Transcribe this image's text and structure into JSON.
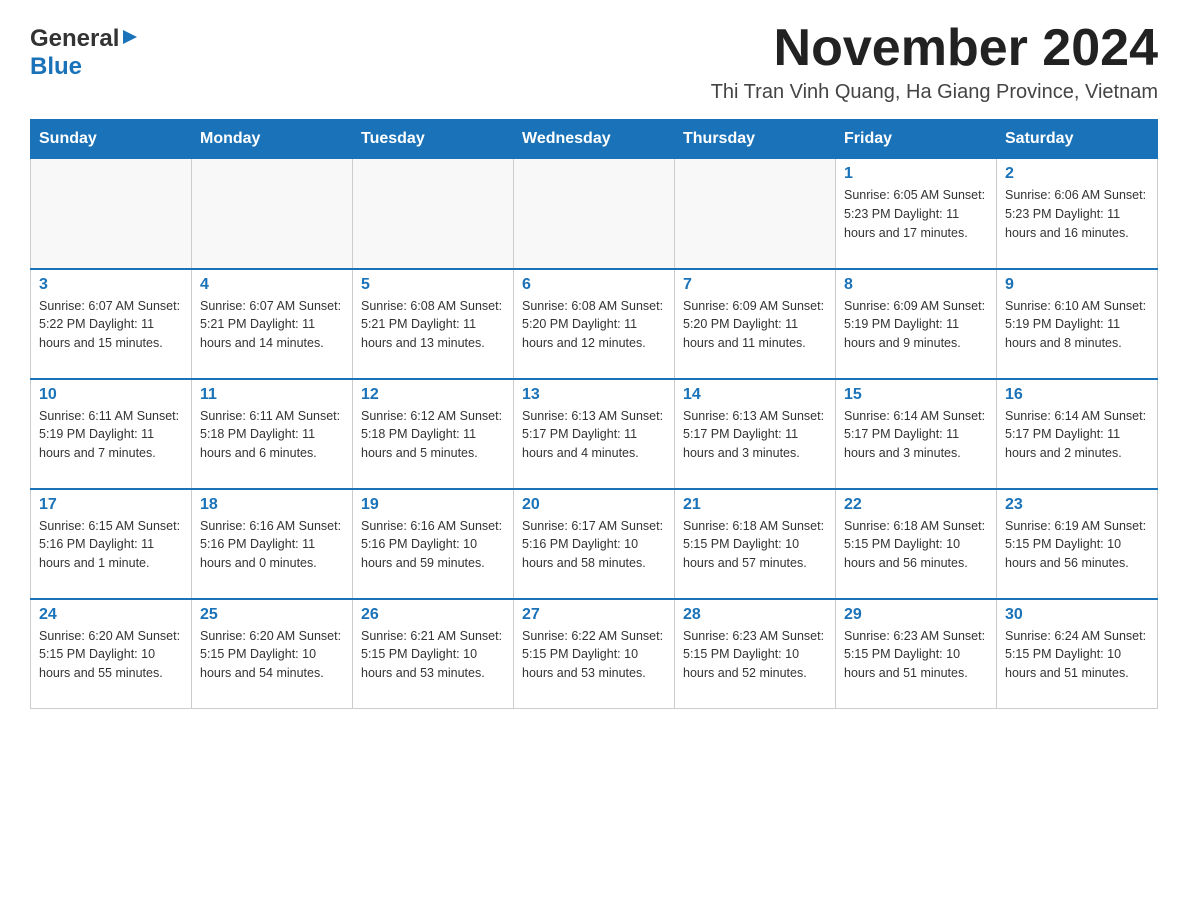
{
  "header": {
    "logo_general": "General",
    "logo_blue": "Blue",
    "title": "November 2024",
    "location": "Thi Tran Vinh Quang, Ha Giang Province, Vietnam"
  },
  "days_of_week": [
    "Sunday",
    "Monday",
    "Tuesday",
    "Wednesday",
    "Thursday",
    "Friday",
    "Saturday"
  ],
  "weeks": [
    {
      "days": [
        {
          "number": "",
          "info": ""
        },
        {
          "number": "",
          "info": ""
        },
        {
          "number": "",
          "info": ""
        },
        {
          "number": "",
          "info": ""
        },
        {
          "number": "",
          "info": ""
        },
        {
          "number": "1",
          "info": "Sunrise: 6:05 AM\nSunset: 5:23 PM\nDaylight: 11 hours and 17 minutes."
        },
        {
          "number": "2",
          "info": "Sunrise: 6:06 AM\nSunset: 5:23 PM\nDaylight: 11 hours and 16 minutes."
        }
      ]
    },
    {
      "days": [
        {
          "number": "3",
          "info": "Sunrise: 6:07 AM\nSunset: 5:22 PM\nDaylight: 11 hours and 15 minutes."
        },
        {
          "number": "4",
          "info": "Sunrise: 6:07 AM\nSunset: 5:21 PM\nDaylight: 11 hours and 14 minutes."
        },
        {
          "number": "5",
          "info": "Sunrise: 6:08 AM\nSunset: 5:21 PM\nDaylight: 11 hours and 13 minutes."
        },
        {
          "number": "6",
          "info": "Sunrise: 6:08 AM\nSunset: 5:20 PM\nDaylight: 11 hours and 12 minutes."
        },
        {
          "number": "7",
          "info": "Sunrise: 6:09 AM\nSunset: 5:20 PM\nDaylight: 11 hours and 11 minutes."
        },
        {
          "number": "8",
          "info": "Sunrise: 6:09 AM\nSunset: 5:19 PM\nDaylight: 11 hours and 9 minutes."
        },
        {
          "number": "9",
          "info": "Sunrise: 6:10 AM\nSunset: 5:19 PM\nDaylight: 11 hours and 8 minutes."
        }
      ]
    },
    {
      "days": [
        {
          "number": "10",
          "info": "Sunrise: 6:11 AM\nSunset: 5:19 PM\nDaylight: 11 hours and 7 minutes."
        },
        {
          "number": "11",
          "info": "Sunrise: 6:11 AM\nSunset: 5:18 PM\nDaylight: 11 hours and 6 minutes."
        },
        {
          "number": "12",
          "info": "Sunrise: 6:12 AM\nSunset: 5:18 PM\nDaylight: 11 hours and 5 minutes."
        },
        {
          "number": "13",
          "info": "Sunrise: 6:13 AM\nSunset: 5:17 PM\nDaylight: 11 hours and 4 minutes."
        },
        {
          "number": "14",
          "info": "Sunrise: 6:13 AM\nSunset: 5:17 PM\nDaylight: 11 hours and 3 minutes."
        },
        {
          "number": "15",
          "info": "Sunrise: 6:14 AM\nSunset: 5:17 PM\nDaylight: 11 hours and 3 minutes."
        },
        {
          "number": "16",
          "info": "Sunrise: 6:14 AM\nSunset: 5:17 PM\nDaylight: 11 hours and 2 minutes."
        }
      ]
    },
    {
      "days": [
        {
          "number": "17",
          "info": "Sunrise: 6:15 AM\nSunset: 5:16 PM\nDaylight: 11 hours and 1 minute."
        },
        {
          "number": "18",
          "info": "Sunrise: 6:16 AM\nSunset: 5:16 PM\nDaylight: 11 hours and 0 minutes."
        },
        {
          "number": "19",
          "info": "Sunrise: 6:16 AM\nSunset: 5:16 PM\nDaylight: 10 hours and 59 minutes."
        },
        {
          "number": "20",
          "info": "Sunrise: 6:17 AM\nSunset: 5:16 PM\nDaylight: 10 hours and 58 minutes."
        },
        {
          "number": "21",
          "info": "Sunrise: 6:18 AM\nSunset: 5:15 PM\nDaylight: 10 hours and 57 minutes."
        },
        {
          "number": "22",
          "info": "Sunrise: 6:18 AM\nSunset: 5:15 PM\nDaylight: 10 hours and 56 minutes."
        },
        {
          "number": "23",
          "info": "Sunrise: 6:19 AM\nSunset: 5:15 PM\nDaylight: 10 hours and 56 minutes."
        }
      ]
    },
    {
      "days": [
        {
          "number": "24",
          "info": "Sunrise: 6:20 AM\nSunset: 5:15 PM\nDaylight: 10 hours and 55 minutes."
        },
        {
          "number": "25",
          "info": "Sunrise: 6:20 AM\nSunset: 5:15 PM\nDaylight: 10 hours and 54 minutes."
        },
        {
          "number": "26",
          "info": "Sunrise: 6:21 AM\nSunset: 5:15 PM\nDaylight: 10 hours and 53 minutes."
        },
        {
          "number": "27",
          "info": "Sunrise: 6:22 AM\nSunset: 5:15 PM\nDaylight: 10 hours and 53 minutes."
        },
        {
          "number": "28",
          "info": "Sunrise: 6:23 AM\nSunset: 5:15 PM\nDaylight: 10 hours and 52 minutes."
        },
        {
          "number": "29",
          "info": "Sunrise: 6:23 AM\nSunset: 5:15 PM\nDaylight: 10 hours and 51 minutes."
        },
        {
          "number": "30",
          "info": "Sunrise: 6:24 AM\nSunset: 5:15 PM\nDaylight: 10 hours and 51 minutes."
        }
      ]
    }
  ]
}
